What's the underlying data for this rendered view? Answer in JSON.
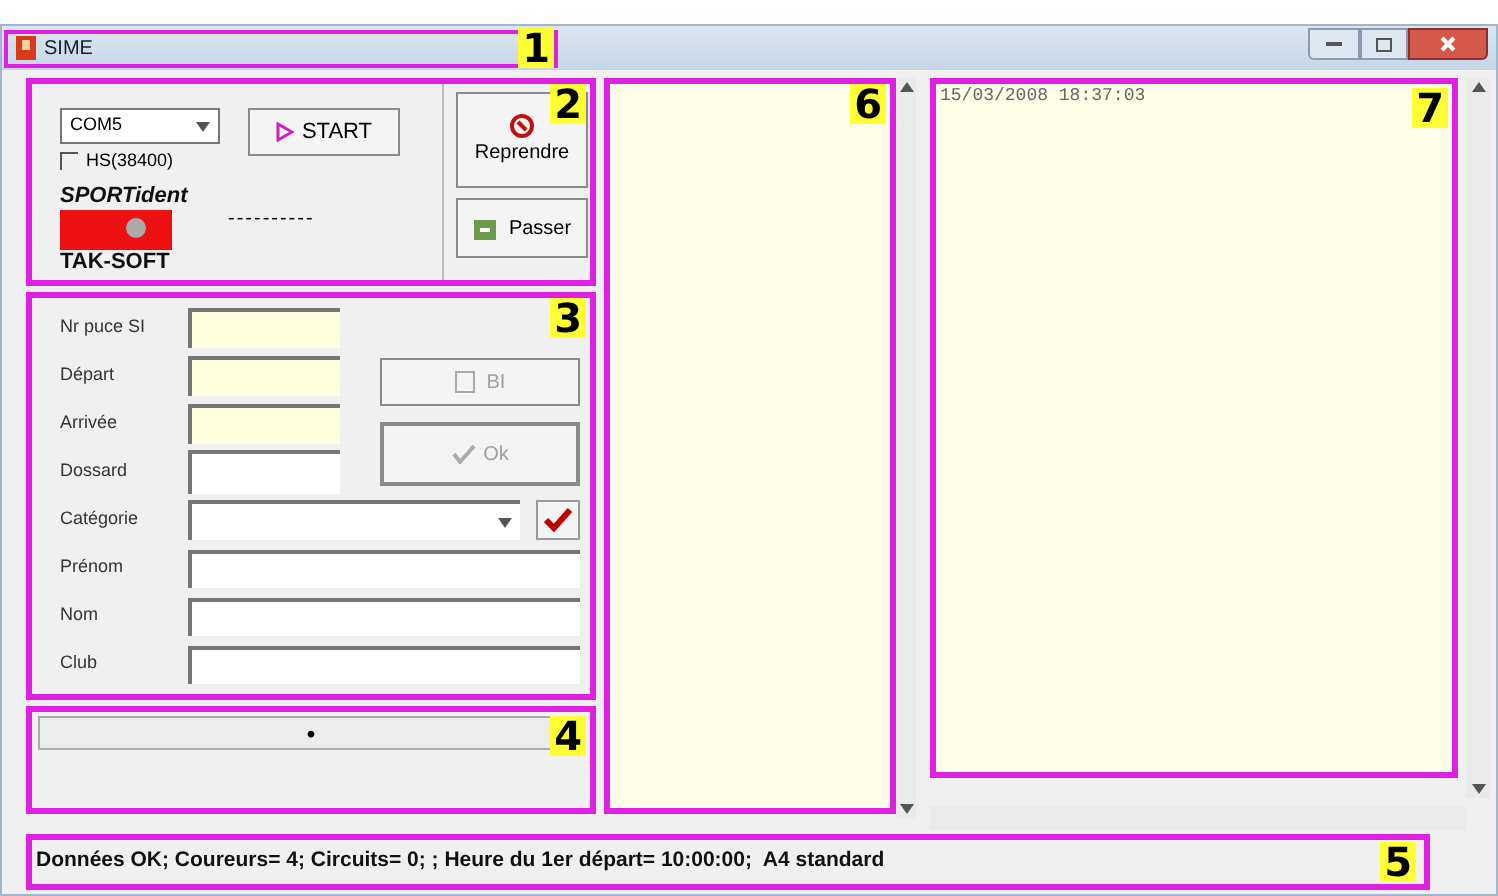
{
  "window": {
    "title": "SIME",
    "badge": "1"
  },
  "control_panel": {
    "badge": "2",
    "port": "COM5",
    "start_button": "START",
    "hs_checkbox": {
      "label": "HS(38400)",
      "checked": false
    },
    "logo_top": "SPORTident",
    "logo_bottom": "TAK-SOFT",
    "dashes": "----------",
    "resume_button": "Reprendre",
    "skip_button": "Passer"
  },
  "form": {
    "badge": "3",
    "fields": [
      {
        "label": "Nr puce SI",
        "kind": "yellow"
      },
      {
        "label": "Départ",
        "kind": "yellow"
      },
      {
        "label": "Arrivée",
        "kind": "yellow"
      },
      {
        "label": "Dossard",
        "kind": "white"
      },
      {
        "label": "Catégorie",
        "kind": "dropdown"
      },
      {
        "label": "Prénom",
        "kind": "wide"
      },
      {
        "label": "Nom",
        "kind": "wide"
      },
      {
        "label": "Club",
        "kind": "wide"
      }
    ],
    "bi_button": {
      "label": "BI",
      "disabled": true
    },
    "ok_button": {
      "label": "Ok",
      "disabled": true
    }
  },
  "progress_panel": {
    "badge": "4",
    "marker": "•"
  },
  "list_panel": {
    "badge": "6"
  },
  "log_panel": {
    "badge": "7",
    "lines": [
      "15/03/2008 18:37:03"
    ]
  },
  "status_bar": {
    "badge": "5",
    "text": "Données OK; Coureurs= 4; Circuits= 0; ; Heure du 1er départ= 10:00:00;  A4 standard"
  }
}
